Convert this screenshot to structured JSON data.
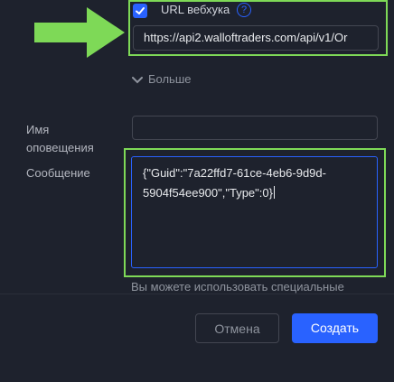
{
  "webhook": {
    "checked": true,
    "label": "URL вебхука",
    "help_glyph": "?",
    "url_value": "https://api2.walloftraders.com/api/v1/Or"
  },
  "more": {
    "label": "Больше",
    "icon": "chevron-down-icon"
  },
  "alert_name": {
    "label": "Имя оповещения",
    "value": ""
  },
  "message": {
    "label": "Сообщение",
    "value": "{\"Guid\":\"7a22ffd7-61ce-4eb6-9d9d-\n5904f54ee900\",\"Type\":0}"
  },
  "hint": "Вы можете использовать специальные",
  "buttons": {
    "cancel": "Отмена",
    "create": "Создать"
  },
  "colors": {
    "accent": "#2962ff",
    "highlight": "#7ed957",
    "background": "#1e222d"
  }
}
